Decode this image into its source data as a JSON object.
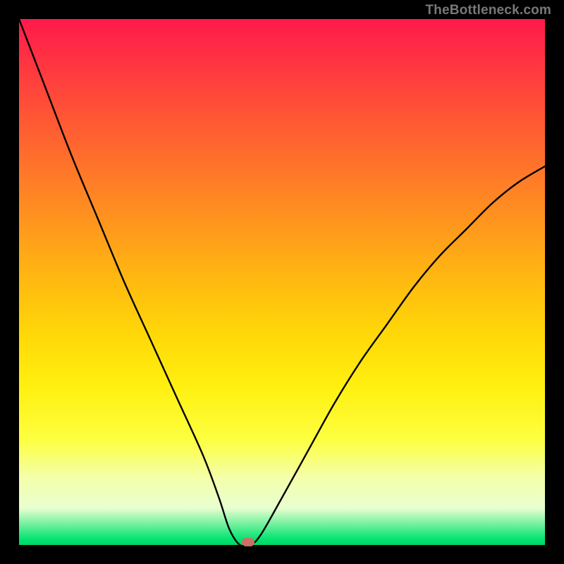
{
  "watermark": "TheBottleneck.com",
  "marker": {
    "x_pct": 43.5,
    "y_pct": 99.4
  },
  "chart_data": {
    "type": "line",
    "title": "",
    "xlabel": "",
    "ylabel": "",
    "xlim": [
      0,
      100
    ],
    "ylim": [
      0,
      100
    ],
    "series": [
      {
        "name": "bottleneck-curve",
        "x": [
          0,
          5,
          10,
          15,
          20,
          25,
          30,
          35,
          38,
          40,
          42,
          44,
          46,
          50,
          55,
          60,
          65,
          70,
          75,
          80,
          85,
          90,
          95,
          100
        ],
        "y": [
          100,
          87,
          74,
          62,
          50,
          39,
          28,
          17,
          9,
          3,
          0,
          0,
          2,
          9,
          18,
          27,
          35,
          42,
          49,
          55,
          60,
          65,
          69,
          72
        ]
      }
    ],
    "annotations": [
      {
        "type": "marker",
        "x": 43.5,
        "y": 0.6,
        "label": "optimal-point"
      }
    ],
    "background_gradient": {
      "top": "#ff1a4b",
      "mid": "#ffe010",
      "bottom": "#00d862"
    }
  }
}
